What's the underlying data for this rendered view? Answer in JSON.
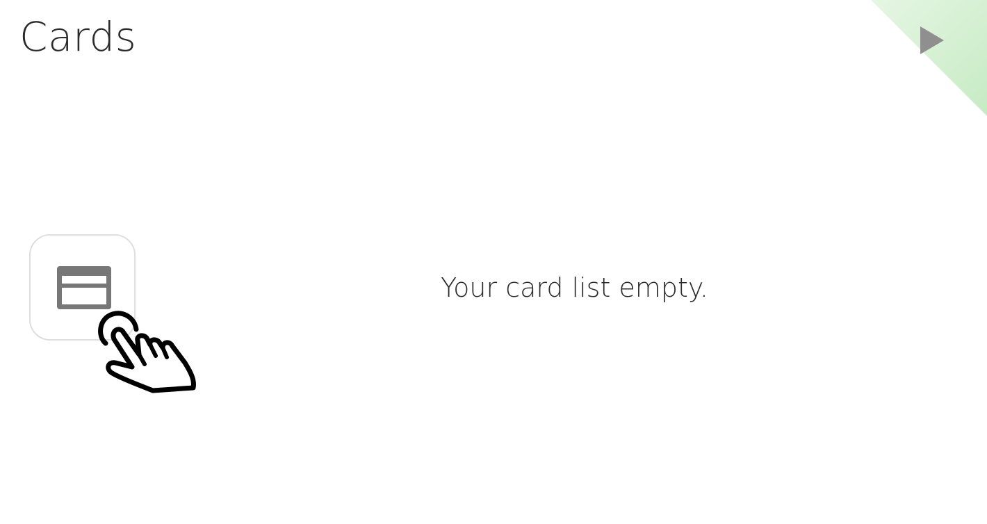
{
  "header": {
    "title": "Cards"
  },
  "navigation": {
    "next_icon": "play-triangle-icon",
    "corner_accent_color": "#c9ecc6"
  },
  "empty_state": {
    "message": "Your card list empty.",
    "card_icon": "credit-card-icon",
    "pointer_icon": "hand-pointer-icon"
  },
  "colors": {
    "title_text": "#2b2b2b",
    "icon_gray": "#777777",
    "tile_border": "#dedede",
    "corner_light": "#e3f5e1",
    "corner_dark": "#c9ecc6"
  }
}
